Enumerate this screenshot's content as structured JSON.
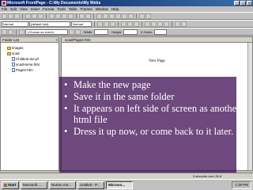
{
  "window": {
    "title": "Microsoft FrontPage - C:\\My Documents\\My Webs"
  },
  "menu": [
    "File",
    "Edit",
    "View",
    "Insert",
    "Format",
    "Tools",
    "Table",
    "Frames",
    "Window",
    "Help"
  ],
  "format_toolbar": {
    "style_value": "Normal",
    "font_value": "(default font)",
    "size_value": "Normal"
  },
  "dhtml_toolbar": {
    "event_value": "<Choose an event>",
    "width_label": "Width:",
    "height_label": "Height:",
    "zorder_label": "Z-Order:"
  },
  "folder_list": {
    "header": "Folder List",
    "close_glyph": "×",
    "items": [
      {
        "label": "images",
        "kind": "folder"
      },
      {
        "label": "scad",
        "kind": "folder"
      },
      {
        "label": "ChildenLine.pf",
        "kind": "file"
      },
      {
        "label": "scadHome.htm",
        "kind": "file"
      },
      {
        "label": "Page2.htm",
        "kind": "file"
      }
    ]
  },
  "editor": {
    "tab_label": "scad/Page2.htm",
    "page_title": "New Page"
  },
  "slide_bullets": [
    "Make the new page",
    "Save it in the same folder",
    "It appears on left side of screen as another html file",
    "Dress it up now, or come back to it later."
  ],
  "status": {
    "text": "0 seconds over 28.8"
  },
  "taskbar": {
    "start_label": "Start",
    "items": [
      "Microsoft ...",
      "Norton Ant...",
      "Untitled - P...",
      "Microso..."
    ],
    "active_index": 3,
    "clock": "1:39 PM"
  }
}
